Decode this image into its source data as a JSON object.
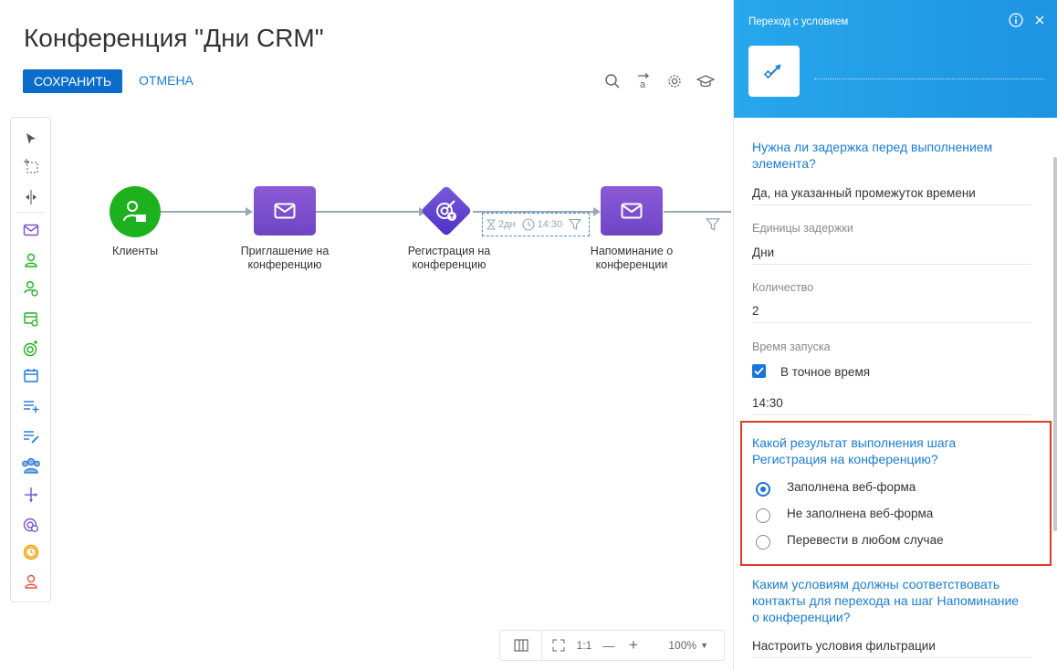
{
  "page_title": "Конференция \"Дни CRM\"",
  "toolbar": {
    "save_label": "СОХРАНИТЬ",
    "cancel_label": "ОТМЕНА"
  },
  "canvas": {
    "nodes": [
      {
        "label": "Клиенты"
      },
      {
        "label": "Приглашение на конференцию"
      },
      {
        "label": "Регистрация на конференцию"
      },
      {
        "label": "Напоминание о конференции"
      }
    ],
    "delay": {
      "days": "2дн",
      "time": "14:30"
    }
  },
  "zoom": {
    "ratio": "1:1",
    "minus": "—",
    "plus": "+",
    "level": "100%"
  },
  "panel": {
    "title": "Переход с условием",
    "q_delay": "Нужна ли задержка перед выполнением элемента?",
    "delay_value": "Да, на указанный промежуток времени",
    "units_label": "Единицы задержки",
    "units_value": "Дни",
    "count_label": "Количество",
    "count_value": "2",
    "start_label": "Время запуска",
    "exact_time_label": "В точное время",
    "exact_time_checked": true,
    "time_value": "14:30",
    "q_result": "Какой результат выполнения шага Регистрация на конференцию?",
    "result_options": [
      {
        "label": "Заполнена веб-форма",
        "selected": true
      },
      {
        "label": "Не заполнена веб-форма",
        "selected": false
      },
      {
        "label": "Перевести в любом случае",
        "selected": false
      }
    ],
    "q_conditions": "Каким условиям должны соответствовать контакты для перехода на шаг Напоминание о конференции?",
    "filter_label": "Настроить условия фильтрации"
  },
  "colors": {
    "accent": "#1a7dd7",
    "save_button": "#0b6ccb",
    "panel_header": "#27a7ec",
    "highlight": "#e23b2c",
    "green_node": "#1db21d",
    "purple_node": "#7b52d3"
  }
}
